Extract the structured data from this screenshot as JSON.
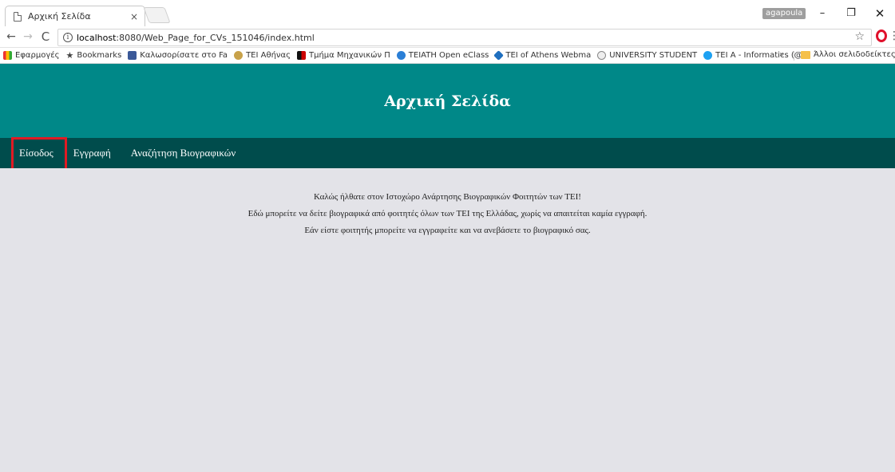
{
  "browser": {
    "tab_title": "Αρχική Σελίδα",
    "tab_close": "×",
    "user_badge": "agapoula",
    "url_host": "localhost",
    "url_path": ":8080/Web_Page_for_CVs_151046/index.html",
    "window": {
      "minimize": "–",
      "maximize": "❐",
      "close": "✕"
    },
    "nav": {
      "back": "←",
      "forward": "→",
      "reload": "C",
      "info": "i",
      "star": "☆",
      "menu": "⋮"
    }
  },
  "bookmarks": {
    "items": [
      {
        "label": "Εφαρμογές",
        "icon": "apps-icon"
      },
      {
        "label": "Bookmarks",
        "icon": "star-icon"
      },
      {
        "label": "Καλωσορίσατε στο Fa",
        "icon": "facebook-icon"
      },
      {
        "label": "ΤΕΙ Αθήνας",
        "icon": "tei-icon"
      },
      {
        "label": "Τμήμα Μηχανικών Π",
        "icon": "department-icon"
      },
      {
        "label": "TEIATH Open eClass",
        "icon": "eclass-icon"
      },
      {
        "label": "TEI of Athens Webma",
        "icon": "webmail-icon"
      },
      {
        "label": "UNIVERSITY STUDENT",
        "icon": "university-icon"
      },
      {
        "label": "TEI A - Informatics (@",
        "icon": "twitter-icon"
      }
    ],
    "more": "»",
    "other": "Άλλοι σελιδοδείκτες"
  },
  "page": {
    "title": "Αρχική Σελίδα",
    "nav": {
      "login": "Είσοδος",
      "register": "Εγγραφή",
      "search": "Αναζήτηση Βιογραφικών"
    },
    "welcome": {
      "line1": "Καλώς ήλθατε στον Ιστοχώρο Ανάρτησης Βιογραφικών Φοιτητών των ΤΕΙ!",
      "line2": "Εδώ μπορείτε να δείτε βιογραφικά από φοιτητές όλων των ΤΕΙ της Ελλάδας, χωρίς να απαιτείται καμία εγγραφή.",
      "line3": "Εάν είστε φοιτητής μπορείτε να εγγραφείτε και να ανεβάσετε το βιογραφικό σας."
    }
  },
  "colors": {
    "header": "#008888",
    "navbar": "#004c4c",
    "content_bg": "#e3e3e8",
    "highlight": "#e01b24"
  }
}
